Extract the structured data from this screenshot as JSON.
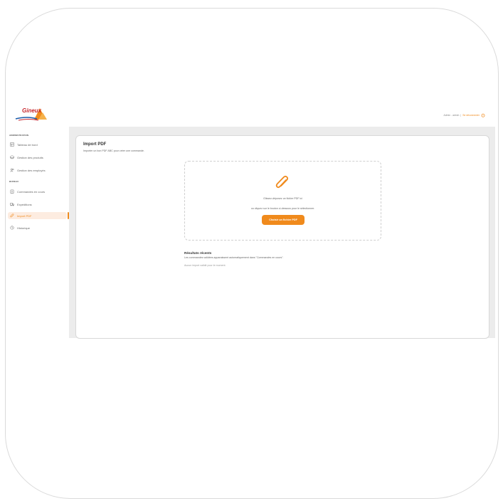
{
  "app": {
    "logo_text": "Gineux",
    "user_label": "Admin - admin",
    "separator": "|",
    "logout_label": "Se déconnecter"
  },
  "sidebar": {
    "sections": [
      {
        "label": "ADMINISTRATION",
        "items": [
          {
            "label": "Tableau de bord",
            "icon": "dashboard-icon"
          },
          {
            "label": "Gestion des produits",
            "icon": "products-icon"
          },
          {
            "label": "Gestion des employés",
            "icon": "employees-icon"
          }
        ]
      },
      {
        "label": "BUREAU",
        "items": [
          {
            "label": "Commandes en cours",
            "icon": "orders-icon"
          },
          {
            "label": "Expéditions",
            "icon": "truck-icon"
          },
          {
            "label": "Import PDF",
            "icon": "paperclip-icon",
            "active": true
          },
          {
            "label": "Historique",
            "icon": "history-icon"
          }
        ]
      }
    ]
  },
  "main": {
    "title": "Import PDF",
    "subtitle": "Importer un bon PDF ABC pour créer une commande.",
    "dropzone": {
      "line1": "Glissez-déposez un fichier PDF ici",
      "line2": "ou cliquez sur le bouton ci-dessous pour le sélectionner.",
      "button_label": "Choisir un fichier PDF"
    },
    "results": {
      "title": "Résultats récents",
      "subtitle": "Les commandes validées apparaissent automatiquement dans \"Commandes en cours\".",
      "empty": "Aucun import validé pour le moment."
    }
  },
  "colors": {
    "accent": "#f08a1c",
    "active_bg": "#fdece0",
    "main_bg": "#ececec"
  }
}
